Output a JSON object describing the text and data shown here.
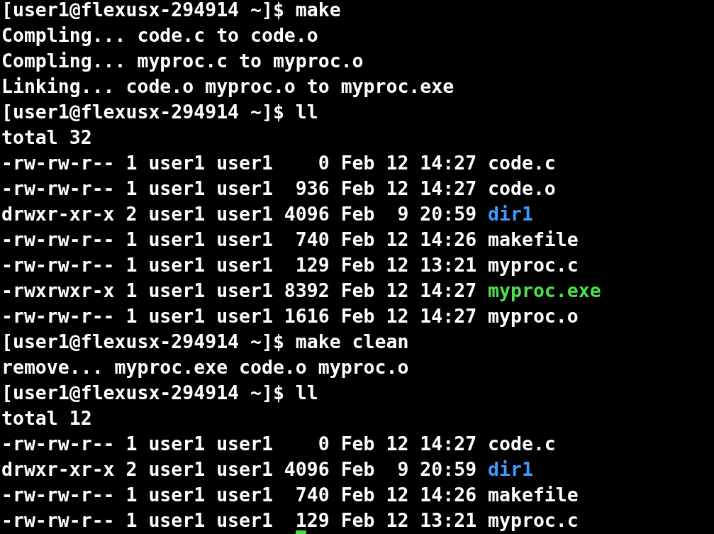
{
  "terminal": {
    "lines": [
      {
        "kind": "prompt",
        "prompt": "[user1@flexusx-294914 ~]$",
        "command": "make"
      },
      {
        "kind": "output",
        "text": "Compling... code.c to code.o"
      },
      {
        "kind": "output",
        "text": "Compling... myproc.c to myproc.o"
      },
      {
        "kind": "output",
        "text": "Linking... code.o myproc.o to myproc.exe"
      },
      {
        "kind": "prompt",
        "prompt": "[user1@flexusx-294914 ~]$",
        "command": "ll"
      },
      {
        "kind": "output",
        "text": "total 32"
      },
      {
        "kind": "file",
        "info": "-rw-rw-r-- 1 user1 user1    0 Feb 12 14:27",
        "name": "code.c",
        "color": "#ffffff"
      },
      {
        "kind": "file",
        "info": "-rw-rw-r-- 1 user1 user1  936 Feb 12 14:27",
        "name": "code.o",
        "color": "#ffffff"
      },
      {
        "kind": "file",
        "info": "drwxr-xr-x 2 user1 user1 4096 Feb  9 20:59",
        "name": "dir1",
        "color": "#3b9cff"
      },
      {
        "kind": "file",
        "info": "-rw-rw-r-- 1 user1 user1  740 Feb 12 14:26",
        "name": "makefile",
        "color": "#ffffff"
      },
      {
        "kind": "file",
        "info": "-rw-rw-r-- 1 user1 user1  129 Feb 12 13:21",
        "name": "myproc.c",
        "color": "#ffffff"
      },
      {
        "kind": "file",
        "info": "-rwxrwxr-x 1 user1 user1 8392 Feb 12 14:27",
        "name": "myproc.exe",
        "color": "#4be24b"
      },
      {
        "kind": "file",
        "info": "-rw-rw-r-- 1 user1 user1 1616 Feb 12 14:27",
        "name": "myproc.o",
        "color": "#ffffff"
      },
      {
        "kind": "prompt",
        "prompt": "[user1@flexusx-294914 ~]$",
        "command": "make clean"
      },
      {
        "kind": "output",
        "text": "remove... myproc.exe code.o myproc.o"
      },
      {
        "kind": "prompt",
        "prompt": "[user1@flexusx-294914 ~]$",
        "command": "ll"
      },
      {
        "kind": "output",
        "text": "total 12"
      },
      {
        "kind": "file",
        "info": "-rw-rw-r-- 1 user1 user1    0 Feb 12 14:27",
        "name": "code.c",
        "color": "#ffffff"
      },
      {
        "kind": "file",
        "info": "drwxr-xr-x 2 user1 user1 4096 Feb  9 20:59",
        "name": "dir1",
        "color": "#3b9cff"
      },
      {
        "kind": "file",
        "info": "-rw-rw-r-- 1 user1 user1  740 Feb 12 14:26",
        "name": "makefile",
        "color": "#ffffff"
      },
      {
        "kind": "file",
        "info": "-rw-rw-r-- 1 user1 user1  129 Feb 12 13:21",
        "name": "myproc.c",
        "color": "#ffffff"
      }
    ]
  }
}
